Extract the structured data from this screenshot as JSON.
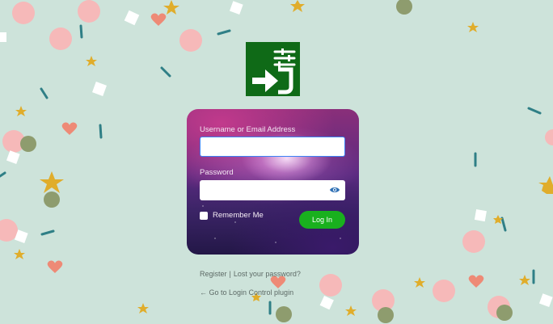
{
  "form": {
    "username_label": "Username or Email Address",
    "username_value": "",
    "password_label": "Password",
    "password_value": "",
    "remember_label": "Remember Me",
    "login_button": "Log In"
  },
  "links": {
    "register": "Register",
    "separator": "|",
    "lost_password": "Lost your password?",
    "back_link": "← Go to Login Control plugin"
  },
  "colors": {
    "background": "#cde3da",
    "logo_bg": "#0f6a17",
    "login_button": "#19b01e",
    "field_focus_border": "#3b82f6"
  },
  "icons": {
    "logo": "login-arrow-settings-icon",
    "password_toggle": "eye-icon"
  }
}
